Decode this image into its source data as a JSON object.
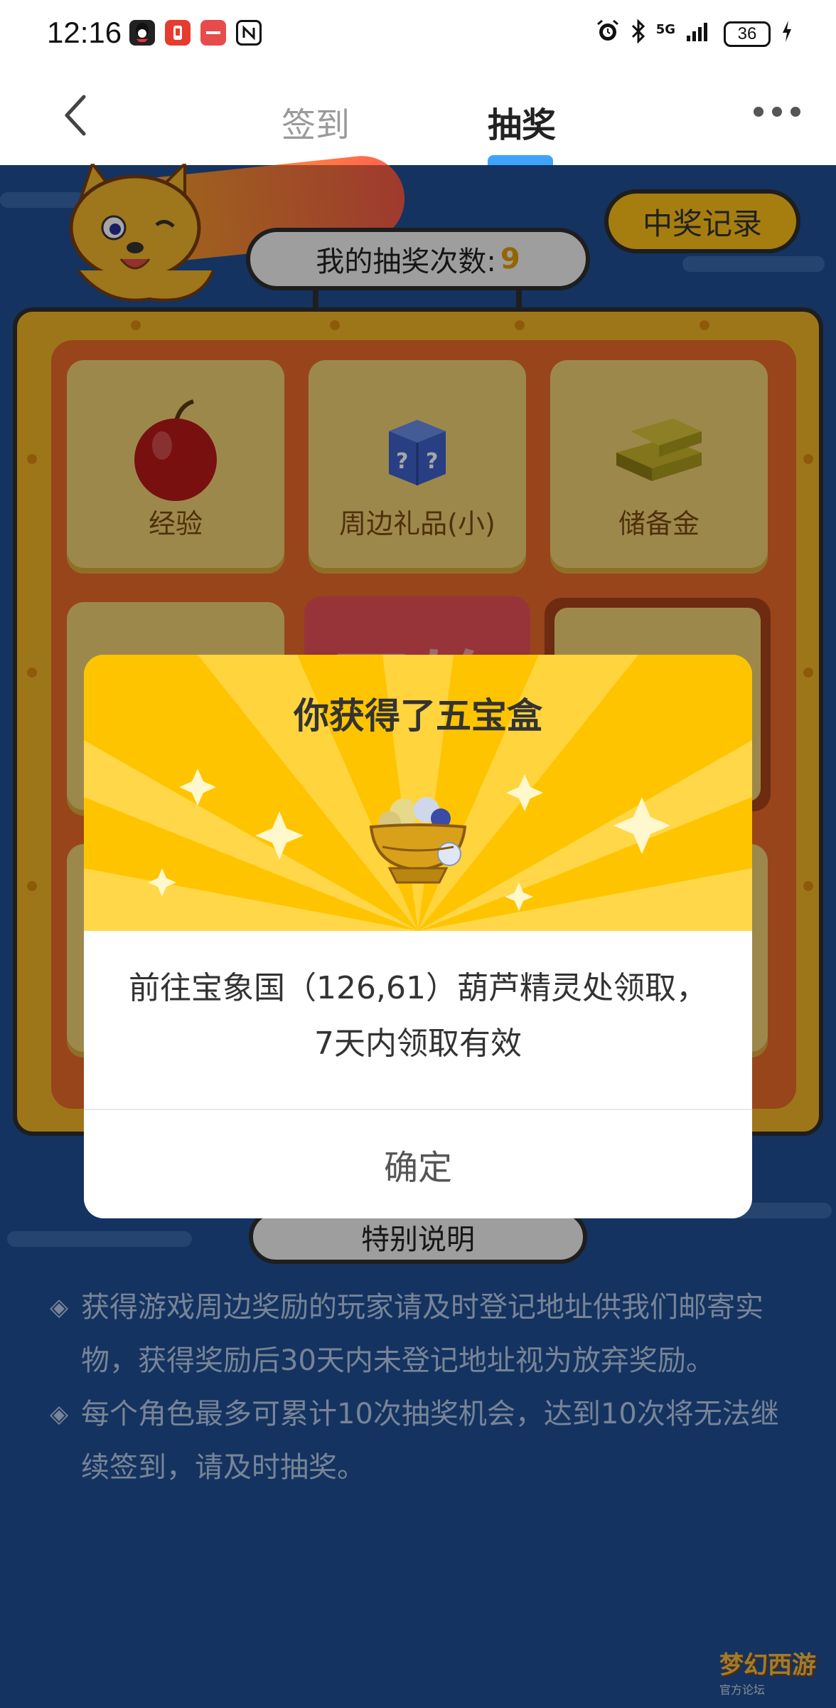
{
  "status_bar": {
    "time": "12:16",
    "network": "5G",
    "battery": "36"
  },
  "nav": {
    "tabs": [
      {
        "label": "签到"
      },
      {
        "label": "抽奖"
      }
    ]
  },
  "lottery": {
    "count_label": "我的抽奖次数:",
    "count_value": "9",
    "record_button": "中奖记录",
    "start_label": "开始",
    "prizes": [
      {
        "label": "经验",
        "icon": "apple-icon"
      },
      {
        "label": "周边礼品(小)",
        "icon": "mystery-box-icon"
      },
      {
        "label": "储备金",
        "icon": "gold-bars-icon"
      }
    ]
  },
  "special": {
    "title": "特别说明",
    "rules": [
      "获得游戏周边奖励的玩家请及时登记地址供我们邮寄实物，获得奖励后30天内未登记地址视为放弃奖励。",
      "每个角色最多可累计10次抽奖机会，达到10次将无法继续签到，请及时抽奖。"
    ]
  },
  "dialog": {
    "title": "你获得了五宝盒",
    "body": "前往宝象国（126,61）葫芦精灵处领取，7天内领取有效",
    "confirm": "确定",
    "prize_icon": "treasure-bowl-icon"
  },
  "watermark": {
    "text": "梦幻西游",
    "sub": "官方论坛"
  },
  "colors": {
    "page_bg": "#1f4f94",
    "accent_blue": "#3da3ff",
    "gold": "#ffc400",
    "count_highlight": "#e39b00",
    "start_red": "#e8515a"
  }
}
